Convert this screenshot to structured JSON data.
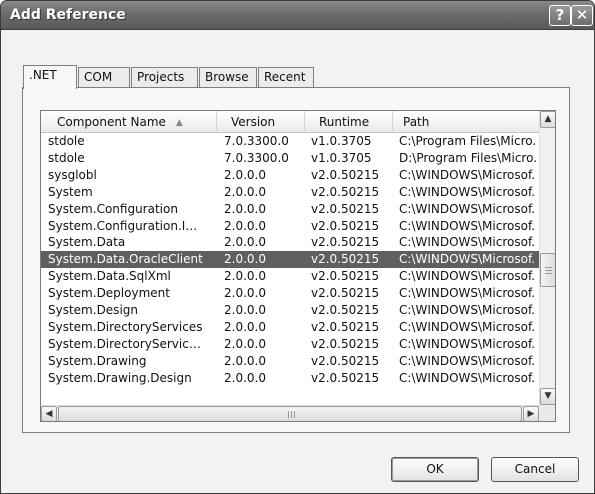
{
  "window": {
    "title": "Add Reference",
    "help_glyph": "?",
    "close_glyph": "✕"
  },
  "tabs": [
    {
      "label": ".NET",
      "active": true
    },
    {
      "label": "COM"
    },
    {
      "label": "Projects"
    },
    {
      "label": "Browse"
    },
    {
      "label": "Recent"
    }
  ],
  "list": {
    "columns": [
      "Component Name",
      "Version",
      "Runtime",
      "Path"
    ],
    "sort_indicator": "▲",
    "rows": [
      [
        "stdole",
        "7.0.3300.0",
        "v1.0.3705",
        "C:\\Program Files\\Micro."
      ],
      [
        "stdole",
        "7.0.3300.0",
        "v1.0.3705",
        "D:\\Program Files\\Micro."
      ],
      [
        "sysglobl",
        "2.0.0.0",
        "v2.0.50215",
        "C:\\WINDOWS\\Microsof."
      ],
      [
        "System",
        "2.0.0.0",
        "v2.0.50215",
        "C:\\WINDOWS\\Microsof."
      ],
      [
        "System.Configuration",
        "2.0.0.0",
        "v2.0.50215",
        "C:\\WINDOWS\\Microsof."
      ],
      [
        "System.Configuration.I…",
        "2.0.0.0",
        "v2.0.50215",
        "C:\\WINDOWS\\Microsof."
      ],
      [
        "System.Data",
        "2.0.0.0",
        "v2.0.50215",
        "C:\\WINDOWS\\Microsof."
      ],
      [
        "System.Data.OracleClient",
        "2.0.0.0",
        "v2.0.50215",
        "C:\\WINDOWS\\Microsof."
      ],
      [
        "System.Data.SqlXml",
        "2.0.0.0",
        "v2.0.50215",
        "C:\\WINDOWS\\Microsof."
      ],
      [
        "System.Deployment",
        "2.0.0.0",
        "v2.0.50215",
        "C:\\WINDOWS\\Microsof."
      ],
      [
        "System.Design",
        "2.0.0.0",
        "v2.0.50215",
        "C:\\WINDOWS\\Microsof."
      ],
      [
        "System.DirectoryServices",
        "2.0.0.0",
        "v2.0.50215",
        "C:\\WINDOWS\\Microsof."
      ],
      [
        "System.DirectoryServic…",
        "2.0.0.0",
        "v2.0.50215",
        "C:\\WINDOWS\\Microsof."
      ],
      [
        "System.Drawing",
        "2.0.0.0",
        "v2.0.50215",
        "C:\\WINDOWS\\Microsof."
      ],
      [
        "System.Drawing.Design",
        "2.0.0.0",
        "v2.0.50215",
        "C:\\WINDOWS\\Microsof."
      ]
    ],
    "selected_index": 7
  },
  "scroll": {
    "up": "▲",
    "down": "▼",
    "left": "◀",
    "right": "▶"
  },
  "buttons": {
    "ok": "OK",
    "cancel": "Cancel"
  }
}
